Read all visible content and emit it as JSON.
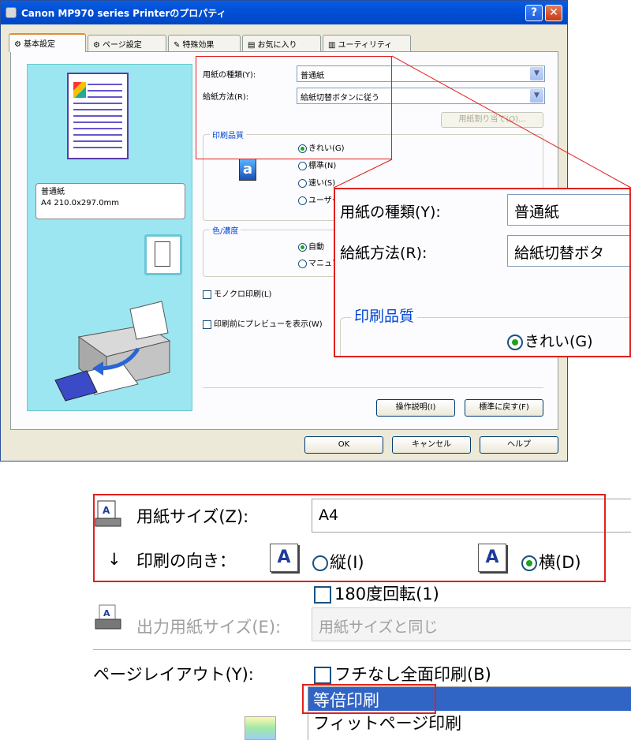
{
  "window": {
    "title": "Canon MP970 series Printerのプロパティ",
    "help_glyph": "?",
    "close_glyph": "✕"
  },
  "tabs": [
    {
      "label": "基本設定",
      "icon": "main-settings-icon"
    },
    {
      "label": "ページ設定",
      "icon": "page-setup-icon"
    },
    {
      "label": "特殊効果",
      "icon": "effects-icon"
    },
    {
      "label": "お気に入り",
      "icon": "favorites-icon"
    },
    {
      "label": "ユーティリティ",
      "icon": "utility-icon"
    }
  ],
  "preview": {
    "paper_line1": "普通紙",
    "paper_line2": "A4 210.0x297.0mm"
  },
  "form": {
    "media_type_label": "用紙の種類(Y):",
    "media_type_value": "普通紙",
    "paper_source_label": "給紙方法(R):",
    "paper_source_value": "給紙切替ボタンに従う",
    "paper_alloc_button": "用紙割り当て(O)...",
    "quality_group": "印刷品質",
    "quality_options": [
      "きれい(G)",
      "標準(N)",
      "速い(S)",
      "ユーザー"
    ],
    "color_group": "色/濃度",
    "color_options": [
      "自動",
      "マニュアル"
    ],
    "grayscale_label": "モノクロ印刷(L)",
    "preview_label": "印刷前にプレビューを表示(W)",
    "instructions_button": "操作説明(I)",
    "defaults_button": "標準に戻す(F)",
    "ok_button": "OK",
    "cancel_button": "キャンセル",
    "help_button": "ヘルプ"
  },
  "zoom": {
    "media_type_label": "用紙の種類(Y):",
    "media_type_value": "普通紙",
    "paper_source_label": "給紙方法(R):",
    "paper_source_value": "給紙切替ボタ",
    "quality_group": "印刷品質",
    "quality_option": "きれい(G)"
  },
  "page_setup": {
    "paper_size_label": "用紙サイズ(Z):",
    "paper_size_value": "A4",
    "orientation_label": "印刷の向き：",
    "portrait_label": "縦(I)",
    "landscape_label": "横(D)",
    "orientation_selected": "landscape",
    "rotate_label": "180度回転(1)",
    "output_size_label": "出力用紙サイズ(E):",
    "output_size_value": "用紙サイズと同じ",
    "layout_label": "ページレイアウト(Y):",
    "borderless_label": "フチなし全面印刷(B)",
    "layout_options": [
      "等倍印刷",
      "フィットページ印刷"
    ],
    "layout_selected": 0
  },
  "colors": {
    "highlight_red": "#e0201c",
    "xp_blue": "#0050d8",
    "selection_blue": "#3165c5"
  }
}
